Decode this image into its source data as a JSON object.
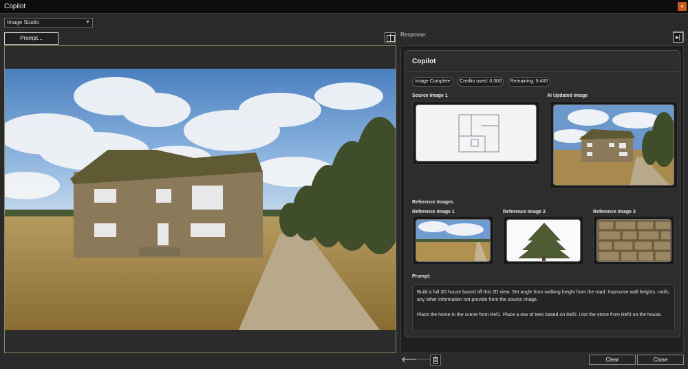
{
  "window": {
    "title": "Copilot",
    "close_glyph": "×"
  },
  "toolbar": {
    "mode_value": "Image Studio",
    "prompt_button": "Prompt...",
    "response_label": "Response:"
  },
  "card": {
    "title": "Copilot",
    "chips": {
      "status": "Image Complete",
      "credits": "Credits used: 0.300",
      "remaining": "Remaining: 9.400"
    },
    "source_label": "Source Image 1",
    "updated_label": "AI Updated Image",
    "refs_heading": "Reference Images",
    "ref1_label": "Reference Image 1",
    "ref2_label": "Reference Image 2",
    "ref3_label": "Reference Image 3",
    "prompt_label": "Prompt:",
    "prompt_line1": "Build a full 3D house based off this 2D view. Set angle from walking height from the road. Improvise wall heights, roofs, any other information not provide from the source image.",
    "prompt_line2": "Place the home in the scene from Ref1. Place a row of tees based on Ref2. Use the stone from Ref3 on the house."
  },
  "footer": {
    "clear_label": "Clear",
    "close_label": "Close",
    "back_glyph": "🡐",
    "forward_glyph": "🡒"
  },
  "icons": {
    "close": "close-icon",
    "split": "split-view-icon",
    "menu": "menu-lines-icon",
    "collapse": "collapse-panel-icon",
    "back": "arrow-left-icon",
    "forward": "arrow-right-icon",
    "trash": "trash-icon"
  },
  "colors": {
    "accent_close": "#c75a1c",
    "canvas_border": "#8a8a62",
    "background": "#2a2a2a"
  }
}
